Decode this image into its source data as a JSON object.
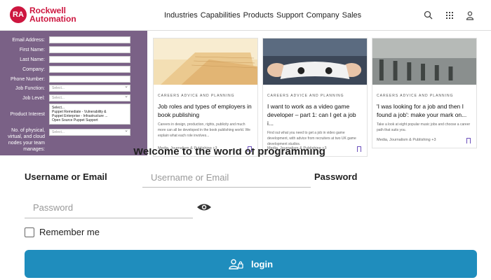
{
  "header": {
    "logo_badge": "RA",
    "logo_line1": "Rockwell",
    "logo_line2": "Automation",
    "nav": [
      "Industries",
      "Capabilities",
      "Products",
      "Support",
      "Company",
      "Sales"
    ],
    "icons": [
      "search-icon",
      "grid-icon",
      "user-icon"
    ]
  },
  "form": {
    "fields": [
      {
        "label": "Email Address:"
      },
      {
        "label": "First Name:"
      },
      {
        "label": "Last Name:"
      },
      {
        "label": "Company:"
      },
      {
        "label": "Phone Number:"
      }
    ],
    "job_function": {
      "label": "Job Function:",
      "placeholder": "Select..."
    },
    "job_level": {
      "label": "Job Level:",
      "placeholder": "Select..."
    },
    "product_interest": {
      "label": "Product Interest",
      "options": [
        "Select...",
        "Puppet Remediate - Vulnerability &",
        "Puppet Enterprise - Infrastructure ...",
        "Open Source Puppet Support"
      ]
    },
    "nodes": {
      "label": "No. of physical, virtual, and cloud nodes your team manages:",
      "placeholder": "Select..."
    }
  },
  "cards": [
    {
      "category": "CAREERS ADVICE AND PLANNING",
      "title": "Job roles and types of employers in book publishing",
      "desc": "Careers in design, production, rights, publicity and much more can all be developed in the book publishing world. We explain what each role involves...",
      "meta": "Media, Journalism & Publishing +3"
    },
    {
      "category": "CAREERS ADVICE AND PLANNING",
      "title": "I want to work as a video game developer – part 1: can I get a job i...",
      "desc": "Find out what you need to get a job in video game development, with advice from recruiters at two UK game development studios.",
      "meta": "Media, Journalism & Publishing +3"
    },
    {
      "category": "CAREERS ADVICE AND PLANNING",
      "title": "'I was looking for a job and then I found a job': make your mark on...",
      "desc": "Take a look at eight popular music jobs and choose a career path that suits you.",
      "meta": "Media, Journalism & Publishing +3"
    }
  ],
  "login": {
    "welcome": "Welcome to the world of programming",
    "user_label": "Username or Email",
    "user_placeholder": "Username or Email",
    "pass_label": "Password",
    "pass_placeholder": "Password",
    "remember": "Remember me",
    "button": "login"
  },
  "colors": {
    "brand": "#cd163f",
    "form_bg": "#7a6186",
    "accent": "#1f8dbd",
    "bookmark": "#6b4fbb"
  }
}
